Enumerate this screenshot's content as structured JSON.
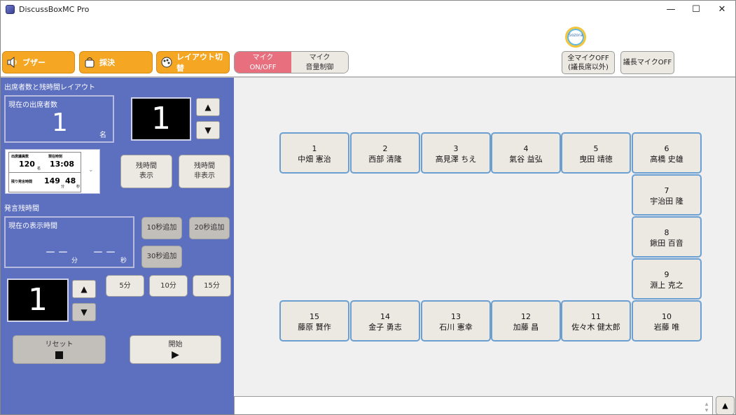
{
  "window": {
    "title": "DiscussBoxMC Pro",
    "minimize": "—",
    "maximize": "☐",
    "close": "✕"
  },
  "toolbar": {
    "buzzer": "ブザー",
    "vote": "採決",
    "layout_switch": "レイアウト切替",
    "mic_onoff_line1": "マイク",
    "mic_onoff_line2": "ON/OFF",
    "mic_volume_line1": "マイク",
    "mic_volume_line2": "音量制御",
    "all_mic_off_line1": "全マイクOFF",
    "all_mic_off_line2": "(議長席以外)",
    "chair_mic_off": "議長マイクOFF",
    "logo_text": "Sozora"
  },
  "attendance": {
    "section_title": "出席者数と残時間レイアウト",
    "current_label": "現在の出席者数",
    "current_value": "1",
    "unit": "名",
    "display_value": "1",
    "preview": {
      "attendees_label": "出席議員数",
      "attendees_value": "120",
      "attendees_unit": "名",
      "time_label": "現在時刻",
      "time_value": "13:08",
      "remaining_label": "残り発言時間",
      "remaining_min": "149",
      "remaining_sec": "48",
      "min_unit": "分",
      "sec_unit": "秒"
    },
    "show_remaining": "残時間\n表示",
    "hide_remaining": "残時間\n非表示"
  },
  "speech": {
    "section_title": "発言残時間",
    "current_label": "現在の表示時間",
    "minutes_value": "－－",
    "min_unit": "分",
    "seconds_value": "－－",
    "sec_unit": "秒",
    "add10": "10秒追加",
    "add20": "20秒追加",
    "add30": "30秒追加",
    "display_value": "1",
    "preset5": "5分",
    "preset10": "10分",
    "preset15": "15分",
    "reset": "リセット",
    "start": "開始"
  },
  "seats": [
    {
      "num": "1",
      "name": "中畑 憲治"
    },
    {
      "num": "2",
      "name": "西部 清隆"
    },
    {
      "num": "3",
      "name": "高見澤 ちえ"
    },
    {
      "num": "4",
      "name": "氣谷 益弘"
    },
    {
      "num": "5",
      "name": "曳田 靖徳"
    },
    {
      "num": "6",
      "name": "高橋 史雄"
    },
    {
      "num": "7",
      "name": "宇治田 隆"
    },
    {
      "num": "8",
      "name": "鍬田 百音"
    },
    {
      "num": "9",
      "name": "淵上 克之"
    },
    {
      "num": "10",
      "name": "岩藤 唯"
    },
    {
      "num": "11",
      "name": "佐々木 健太郎"
    },
    {
      "num": "12",
      "name": "加藤 昌"
    },
    {
      "num": "13",
      "name": "石川 憲幸"
    },
    {
      "num": "14",
      "name": "金子 勇志"
    },
    {
      "num": "15",
      "name": "藤原 賢作"
    }
  ],
  "colors": {
    "accent_orange": "#f5a623",
    "mic_active": "#e8707e",
    "panel_blue": "#5d6fbf",
    "seat_border": "#6b9fd1"
  },
  "icons": {
    "buzzer": "speaker-icon",
    "vote": "bag-icon",
    "layout": "palette-icon",
    "up": "up-arrow-icon",
    "down": "down-arrow-icon"
  }
}
